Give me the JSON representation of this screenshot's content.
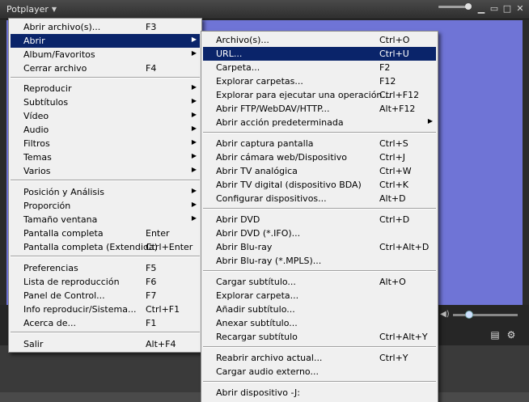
{
  "app": {
    "title": "Potplayer"
  },
  "main_menu": {
    "items": [
      {
        "label": "Abrir archivo(s)...",
        "shortcut": "F3",
        "submenu": false
      },
      {
        "label": "Abrir",
        "shortcut": "",
        "submenu": true,
        "highlighted": true
      },
      {
        "label": "Album/Favoritos",
        "shortcut": "",
        "submenu": true
      },
      {
        "label": "Cerrar archivo",
        "shortcut": "F4",
        "submenu": false
      },
      {
        "label": "Reproducir",
        "shortcut": "",
        "submenu": true
      },
      {
        "label": "Subtítulos",
        "shortcut": "",
        "submenu": true
      },
      {
        "label": "Vídeo",
        "shortcut": "",
        "submenu": true
      },
      {
        "label": "Audio",
        "shortcut": "",
        "submenu": true
      },
      {
        "label": "Filtros",
        "shortcut": "",
        "submenu": true
      },
      {
        "label": "Temas",
        "shortcut": "",
        "submenu": true
      },
      {
        "label": "Varios",
        "shortcut": "",
        "submenu": true
      },
      {
        "label": "Posición y Análisis",
        "shortcut": "",
        "submenu": true
      },
      {
        "label": "Proporción",
        "shortcut": "",
        "submenu": true
      },
      {
        "label": "Tamaño ventana",
        "shortcut": "",
        "submenu": true
      },
      {
        "label": "Pantalla completa",
        "shortcut": "Enter",
        "submenu": false
      },
      {
        "label": "Pantalla completa (Extendida)",
        "shortcut": "Ctrl+Enter",
        "submenu": false
      },
      {
        "label": "Preferencias",
        "shortcut": "F5",
        "submenu": false
      },
      {
        "label": "Lista de reproducción",
        "shortcut": "F6",
        "submenu": false
      },
      {
        "label": "Panel de Control...",
        "shortcut": "F7",
        "submenu": false
      },
      {
        "label": "Info reproducir/Sistema...",
        "shortcut": "Ctrl+F1",
        "submenu": false
      },
      {
        "label": "Acerca de...",
        "shortcut": "F1",
        "submenu": false
      },
      {
        "label": "Salir",
        "shortcut": "Alt+F4",
        "submenu": false
      }
    ]
  },
  "sub_menu": {
    "items": [
      {
        "label": "Archivo(s)...",
        "shortcut": "Ctrl+O",
        "submenu": false
      },
      {
        "label": "URL...",
        "shortcut": "Ctrl+U",
        "submenu": false,
        "highlighted": true
      },
      {
        "label": "Carpeta...",
        "shortcut": "F2",
        "submenu": false
      },
      {
        "label": "Explorar carpetas...",
        "shortcut": "F12",
        "submenu": false
      },
      {
        "label": "Explorar para ejecutar una operación...",
        "shortcut": "Ctrl+F12",
        "submenu": false
      },
      {
        "label": "Abrir FTP/WebDAV/HTTP...",
        "shortcut": "Alt+F12",
        "submenu": false
      },
      {
        "label": "Abrir acción predeterminada",
        "shortcut": "",
        "submenu": true
      },
      {
        "label": "Abrir captura pantalla",
        "shortcut": "Ctrl+S",
        "submenu": false
      },
      {
        "label": "Abrir cámara web/Dispositivo",
        "shortcut": "Ctrl+J",
        "submenu": false
      },
      {
        "label": "Abrir TV analógica",
        "shortcut": "Ctrl+W",
        "submenu": false
      },
      {
        "label": "Abrir TV digital (dispositivo BDA)",
        "shortcut": "Ctrl+K",
        "submenu": false
      },
      {
        "label": "Configurar dispositivos...",
        "shortcut": "Alt+D",
        "submenu": false
      },
      {
        "label": "Abrir DVD",
        "shortcut": "Ctrl+D",
        "submenu": false
      },
      {
        "label": "Abrir DVD (*.IFO)...",
        "shortcut": "",
        "submenu": false
      },
      {
        "label": "Abrir Blu-ray",
        "shortcut": "Ctrl+Alt+D",
        "submenu": false
      },
      {
        "label": "Abrir Blu-ray (*.MPLS)...",
        "shortcut": "",
        "submenu": false
      },
      {
        "label": "Cargar subtítulo...",
        "shortcut": "Alt+O",
        "submenu": false
      },
      {
        "label": "Explorar carpeta...",
        "shortcut": "",
        "submenu": false
      },
      {
        "label": "Añadir subtítulo...",
        "shortcut": "",
        "submenu": false
      },
      {
        "label": "Anexar subtítulo...",
        "shortcut": "",
        "submenu": false
      },
      {
        "label": "Recargar subtítulo",
        "shortcut": "Ctrl+Alt+Y",
        "submenu": false
      },
      {
        "label": "Reabrir archivo actual...",
        "shortcut": "Ctrl+Y",
        "submenu": false
      },
      {
        "label": "Cargar audio externo...",
        "shortcut": "",
        "submenu": false
      },
      {
        "label": "Abrir dispositivo -J:",
        "shortcut": "",
        "submenu": false
      }
    ]
  },
  "colors": {
    "highlight": "#0a246a",
    "video": "#6f74d6",
    "menu_bg": "#f0f0f0"
  },
  "icons": {
    "title_dropdown": "triangle-down",
    "minimize": "minimize",
    "maximize": "maximize",
    "close": "close",
    "playlist": "playlist",
    "settings": "gear"
  }
}
